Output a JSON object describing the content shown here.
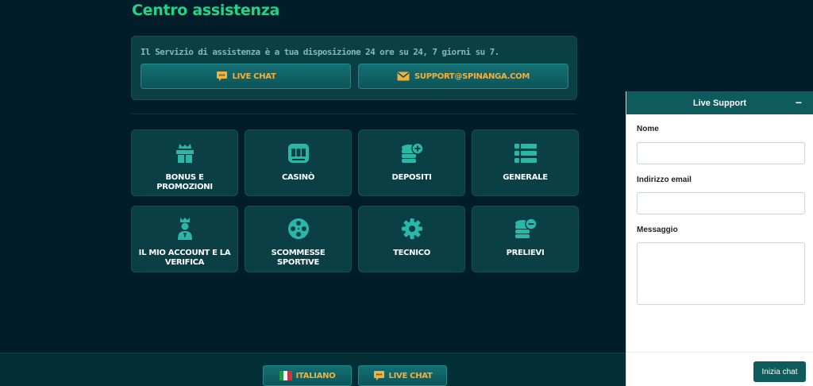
{
  "page": {
    "title": "Centro assistenza"
  },
  "support": {
    "text": "Il Servizio di assistenza è a tua disposizione 24 ore su 24, 7 giorni su 7.",
    "live_chat_label": "LIVE CHAT",
    "email_label": "SUPPORT@SPINANGA.COM"
  },
  "categories": [
    {
      "label": "BONUS E PROMOZIONI",
      "icon": "gift-icon"
    },
    {
      "label": "CASINÒ",
      "icon": "slot-machine-icon"
    },
    {
      "label": "DEPOSITI",
      "icon": "coins-plus-icon"
    },
    {
      "label": "GENERALE",
      "icon": "list-icon"
    },
    {
      "label": "IL MIO ACCOUNT E LA VERIFICA",
      "icon": "user-crown-icon"
    },
    {
      "label": "SCOMMESSE SPORTIVE",
      "icon": "film-reel-icon"
    },
    {
      "label": "TECNICO",
      "icon": "gear-icon"
    },
    {
      "label": "PRELIEVI",
      "icon": "coins-minus-icon"
    }
  ],
  "footer": {
    "language_label": "ITALIANO",
    "live_chat_label": "LIVE CHAT"
  },
  "live_support": {
    "title": "Live Support",
    "minimize": "−",
    "name_label": "Nome",
    "email_label": "Indirizzo email",
    "message_label": "Messaggio",
    "start_button": "Inizia chat"
  },
  "colors": {
    "accent_green": "#20d48a",
    "accent_orange": "#f3b13c",
    "icon_teal": "#2bb7a8",
    "panel_header": "#0d5b5c"
  }
}
